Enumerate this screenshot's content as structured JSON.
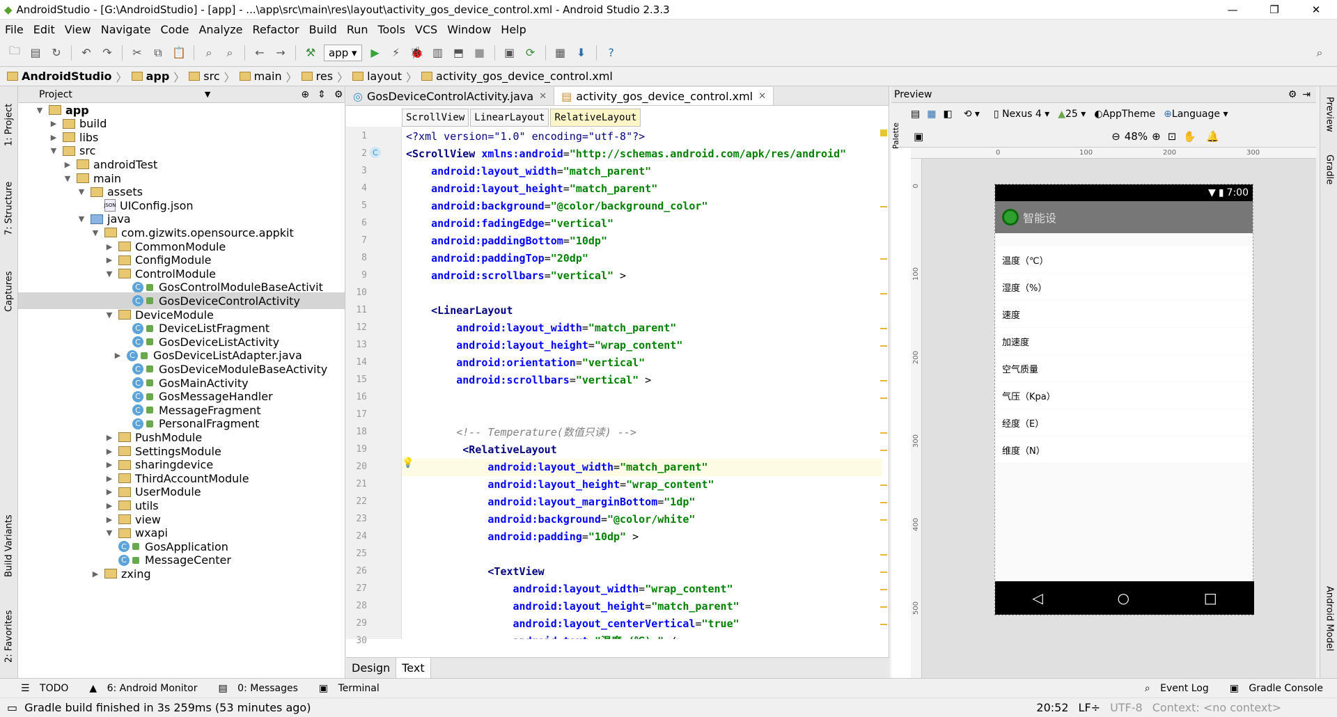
{
  "window": {
    "title": "AndroidStudio - [G:\\AndroidStudio] - [app] - ...\\app\\src\\main\\res\\layout\\activity_gos_device_control.xml - Android Studio 2.3.3"
  },
  "menu": [
    "File",
    "Edit",
    "View",
    "Navigate",
    "Code",
    "Analyze",
    "Refactor",
    "Build",
    "Run",
    "Tools",
    "VCS",
    "Window",
    "Help"
  ],
  "toolbar": {
    "run_config": "app"
  },
  "breadcrumb": [
    "AndroidStudio",
    "app",
    "src",
    "main",
    "res",
    "layout",
    "activity_gos_device_control.xml"
  ],
  "project": {
    "header": "Project",
    "tree": [
      {
        "label": "app",
        "depth": 1,
        "arrow": "▼",
        "icon": "folder"
      },
      {
        "label": "build",
        "depth": 2,
        "arrow": "▶",
        "icon": "folder"
      },
      {
        "label": "libs",
        "depth": 2,
        "arrow": "▶",
        "icon": "folder"
      },
      {
        "label": "src",
        "depth": 2,
        "arrow": "▼",
        "icon": "folder"
      },
      {
        "label": "androidTest",
        "depth": 3,
        "arrow": "▶",
        "icon": "folder"
      },
      {
        "label": "main",
        "depth": 3,
        "arrow": "▼",
        "icon": "folder"
      },
      {
        "label": "assets",
        "depth": 4,
        "arrow": "▼",
        "icon": "folder"
      },
      {
        "label": "UIConfig.json",
        "depth": 5,
        "arrow": "",
        "icon": "json"
      },
      {
        "label": "java",
        "depth": 4,
        "arrow": "▼",
        "icon": "folder-blue"
      },
      {
        "label": "com.gizwits.opensource.appkit",
        "depth": 5,
        "arrow": "▼",
        "icon": "folder"
      },
      {
        "label": "CommonModule",
        "depth": 6,
        "arrow": "▶",
        "icon": "folder"
      },
      {
        "label": "ConfigModule",
        "depth": 6,
        "arrow": "▶",
        "icon": "folder"
      },
      {
        "label": "ControlModule",
        "depth": 6,
        "arrow": "▼",
        "icon": "folder"
      },
      {
        "label": "GosControlModuleBaseActivit",
        "depth": 7,
        "arrow": "",
        "icon": "class"
      },
      {
        "label": "GosDeviceControlActivity",
        "depth": 7,
        "arrow": "",
        "icon": "class",
        "selected": true
      },
      {
        "label": "DeviceModule",
        "depth": 6,
        "arrow": "▼",
        "icon": "folder"
      },
      {
        "label": "DeviceListFragment",
        "depth": 7,
        "arrow": "",
        "icon": "class"
      },
      {
        "label": "GosDeviceListActivity",
        "depth": 7,
        "arrow": "",
        "icon": "class"
      },
      {
        "label": "GosDeviceListAdapter.java",
        "depth": 6.6,
        "arrow": "▶",
        "icon": "class"
      },
      {
        "label": "GosDeviceModuleBaseActivity",
        "depth": 7,
        "arrow": "",
        "icon": "class"
      },
      {
        "label": "GosMainActivity",
        "depth": 7,
        "arrow": "",
        "icon": "class"
      },
      {
        "label": "GosMessageHandler",
        "depth": 7,
        "arrow": "",
        "icon": "class"
      },
      {
        "label": "MessageFragment",
        "depth": 7,
        "arrow": "",
        "icon": "class"
      },
      {
        "label": "PersonalFragment",
        "depth": 7,
        "arrow": "",
        "icon": "class"
      },
      {
        "label": "PushModule",
        "depth": 6,
        "arrow": "▶",
        "icon": "folder"
      },
      {
        "label": "SettingsModule",
        "depth": 6,
        "arrow": "▶",
        "icon": "folder"
      },
      {
        "label": "sharingdevice",
        "depth": 6,
        "arrow": "▶",
        "icon": "folder"
      },
      {
        "label": "ThirdAccountModule",
        "depth": 6,
        "arrow": "▶",
        "icon": "folder"
      },
      {
        "label": "UserModule",
        "depth": 6,
        "arrow": "▶",
        "icon": "folder"
      },
      {
        "label": "utils",
        "depth": 6,
        "arrow": "▶",
        "icon": "folder"
      },
      {
        "label": "view",
        "depth": 6,
        "arrow": "▶",
        "icon": "folder"
      },
      {
        "label": "wxapi",
        "depth": 6,
        "arrow": "▼",
        "icon": "folder"
      },
      {
        "label": "GosApplication",
        "depth": 6,
        "arrow": "",
        "icon": "class"
      },
      {
        "label": "MessageCenter",
        "depth": 6,
        "arrow": "",
        "icon": "class"
      },
      {
        "label": "zxing",
        "depth": 5,
        "arrow": "▶",
        "icon": "folder"
      }
    ]
  },
  "editor": {
    "tabs": [
      {
        "label": "GosDeviceControlActivity.java",
        "active": false
      },
      {
        "label": "activity_gos_device_control.xml",
        "active": true
      }
    ],
    "xml_breadcrumb": [
      "ScrollView",
      "LinearLayout",
      "RelativeLayout"
    ],
    "lines": [
      {
        "n": "1",
        "parts": [
          [
            "pi",
            "<?xml version=\"1.0\" encoding=\"utf-8\"?>"
          ]
        ]
      },
      {
        "n": "2",
        "parts": [
          [
            "kw",
            "<ScrollView "
          ],
          [
            "at",
            "xmlns:android"
          ],
          [
            "",
            "="
          ],
          [
            "st",
            "\"http://schemas.android.com/apk/res/android\""
          ]
        ]
      },
      {
        "n": "3",
        "parts": [
          [
            "",
            "    "
          ],
          [
            "at",
            "android:layout_width"
          ],
          [
            "",
            "="
          ],
          [
            "st",
            "\"match_parent\""
          ]
        ]
      },
      {
        "n": "4",
        "parts": [
          [
            "",
            "    "
          ],
          [
            "at",
            "android:layout_height"
          ],
          [
            "",
            "="
          ],
          [
            "st",
            "\"match_parent\""
          ]
        ]
      },
      {
        "n": "5",
        "parts": [
          [
            "",
            "    "
          ],
          [
            "at",
            "android:background"
          ],
          [
            "",
            "="
          ],
          [
            "st",
            "\"@color/background_color\""
          ]
        ]
      },
      {
        "n": "6",
        "parts": [
          [
            "",
            "    "
          ],
          [
            "at",
            "android:fadingEdge"
          ],
          [
            "",
            "="
          ],
          [
            "st",
            "\"vertical\""
          ]
        ]
      },
      {
        "n": "7",
        "parts": [
          [
            "",
            "    "
          ],
          [
            "at",
            "android:paddingBottom"
          ],
          [
            "",
            "="
          ],
          [
            "st",
            "\"10dp\""
          ]
        ]
      },
      {
        "n": "8",
        "parts": [
          [
            "",
            "    "
          ],
          [
            "at",
            "android:paddingTop"
          ],
          [
            "",
            "="
          ],
          [
            "st",
            "\"20dp\""
          ]
        ]
      },
      {
        "n": "9",
        "parts": [
          [
            "",
            "    "
          ],
          [
            "at",
            "android:scrollbars"
          ],
          [
            "",
            "="
          ],
          [
            "st",
            "\"vertical\""
          ],
          [
            "",
            " >"
          ]
        ]
      },
      {
        "n": "10",
        "parts": [
          [
            "",
            ""
          ]
        ]
      },
      {
        "n": "11",
        "parts": [
          [
            "",
            "    "
          ],
          [
            "kw",
            "<LinearLayout"
          ]
        ]
      },
      {
        "n": "12",
        "parts": [
          [
            "",
            "        "
          ],
          [
            "at",
            "android:layout_width"
          ],
          [
            "",
            "="
          ],
          [
            "st",
            "\"match_parent\""
          ]
        ]
      },
      {
        "n": "13",
        "parts": [
          [
            "",
            "        "
          ],
          [
            "at",
            "android:layout_height"
          ],
          [
            "",
            "="
          ],
          [
            "st",
            "\"wrap_content\""
          ]
        ]
      },
      {
        "n": "14",
        "parts": [
          [
            "",
            "        "
          ],
          [
            "at",
            "android:orientation"
          ],
          [
            "",
            "="
          ],
          [
            "st",
            "\"vertical\""
          ]
        ]
      },
      {
        "n": "15",
        "parts": [
          [
            "",
            "        "
          ],
          [
            "at",
            "android:scrollbars"
          ],
          [
            "",
            "="
          ],
          [
            "st",
            "\"vertical\""
          ],
          [
            "",
            " >"
          ]
        ]
      },
      {
        "n": "16",
        "parts": [
          [
            "",
            ""
          ]
        ]
      },
      {
        "n": "17",
        "parts": [
          [
            "",
            ""
          ]
        ]
      },
      {
        "n": "18",
        "parts": [
          [
            "",
            "        "
          ],
          [
            "cm",
            "<!-- Temperature(数值只读) -->"
          ]
        ]
      },
      {
        "n": "19",
        "parts": [
          [
            "",
            "         "
          ],
          [
            "kw",
            "<RelativeLayout"
          ]
        ]
      },
      {
        "n": "20",
        "parts": [
          [
            "",
            "             "
          ],
          [
            "at",
            "android:layout_width"
          ],
          [
            "",
            "="
          ],
          [
            "st",
            "\"match_parent\""
          ]
        ],
        "hl": true
      },
      {
        "n": "21",
        "parts": [
          [
            "",
            "             "
          ],
          [
            "at",
            "android:layout_height"
          ],
          [
            "",
            "="
          ],
          [
            "st",
            "\"wrap_content\""
          ]
        ]
      },
      {
        "n": "22",
        "parts": [
          [
            "",
            "             "
          ],
          [
            "at",
            "android:layout_marginBottom"
          ],
          [
            "",
            "="
          ],
          [
            "st",
            "\"1dp\""
          ]
        ]
      },
      {
        "n": "23",
        "parts": [
          [
            "",
            "             "
          ],
          [
            "at",
            "android:background"
          ],
          [
            "",
            "="
          ],
          [
            "st",
            "\"@color/white\""
          ]
        ]
      },
      {
        "n": "24",
        "parts": [
          [
            "",
            "             "
          ],
          [
            "at",
            "android:padding"
          ],
          [
            "",
            "="
          ],
          [
            "st",
            "\"10dp\""
          ],
          [
            "",
            " >"
          ]
        ]
      },
      {
        "n": "25",
        "parts": [
          [
            "",
            ""
          ]
        ]
      },
      {
        "n": "26",
        "parts": [
          [
            "",
            "             "
          ],
          [
            "kw",
            "<TextView"
          ]
        ]
      },
      {
        "n": "27",
        "parts": [
          [
            "",
            "                 "
          ],
          [
            "at",
            "android:layout_width"
          ],
          [
            "",
            "="
          ],
          [
            "st",
            "\"wrap_content\""
          ]
        ]
      },
      {
        "n": "28",
        "parts": [
          [
            "",
            "                 "
          ],
          [
            "at",
            "android:layout_height"
          ],
          [
            "",
            "="
          ],
          [
            "st",
            "\"match_parent\""
          ]
        ]
      },
      {
        "n": "29",
        "parts": [
          [
            "",
            "                 "
          ],
          [
            "at",
            "android:layout_centerVertical"
          ],
          [
            "",
            "="
          ],
          [
            "st",
            "\"true\""
          ]
        ]
      },
      {
        "n": "30",
        "parts": [
          [
            "",
            "                 "
          ],
          [
            "at",
            "android:text"
          ],
          [
            "",
            "="
          ],
          [
            "st",
            "\"温度 (℃) \""
          ],
          [
            "",
            " />"
          ]
        ]
      }
    ],
    "design_tabs": [
      "Design",
      "Text"
    ]
  },
  "preview": {
    "header": "Preview",
    "device": "Nexus 4",
    "api": "25",
    "theme": "AppTheme",
    "language": "Language",
    "zoom": "48%",
    "ruler_h": [
      "0",
      "100",
      "200",
      "300"
    ],
    "ruler_v": [
      "0",
      "100",
      "200",
      "300",
      "400",
      "500"
    ],
    "phone": {
      "time": "7:00",
      "app_title": "智能设",
      "rows": [
        "温度（℃）",
        "湿度（%）",
        "速度",
        "加速度",
        "空气质量",
        "气压（Kpa）",
        "经度（E）",
        "维度（N）"
      ]
    }
  },
  "left_strip": [
    "1: Project",
    "7: Structure",
    "Captures",
    "Build Variants",
    "2: Favorites"
  ],
  "right_strip": [
    "Preview",
    "Gradle",
    "Android Model"
  ],
  "tool_windows": [
    "TODO",
    "6: Android Monitor",
    "0: Messages",
    "Terminal",
    "Event Log",
    "Gradle Console"
  ],
  "status": {
    "message": "Gradle build finished in 3s 259ms (53 minutes ago)",
    "position": "20:52",
    "line_sep": "LF÷",
    "encoding": "UTF-8",
    "context": "Context: <no context>"
  },
  "colors": {
    "accent": "#3592c4",
    "selection": "#d5d5d5",
    "xml_tag": "#000080",
    "xml_attr": "#0000ff",
    "xml_value": "#008000"
  }
}
